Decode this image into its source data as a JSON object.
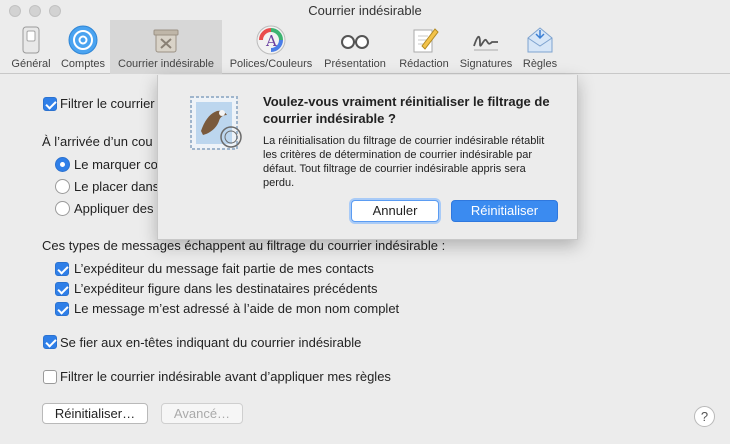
{
  "window": {
    "title": "Courrier indésirable"
  },
  "toolbar": {
    "items": [
      {
        "label": "Général",
        "icon": "general-switch-icon"
      },
      {
        "label": "Comptes",
        "icon": "at-sign-icon"
      },
      {
        "label": "Courrier indésirable",
        "icon": "junk-trash-icon",
        "active": true
      },
      {
        "label": "Polices/Couleurs",
        "icon": "font-colors-icon"
      },
      {
        "label": "Présentation",
        "icon": "glasses-icon"
      },
      {
        "label": "Rédaction",
        "icon": "pencil-notepad-icon"
      },
      {
        "label": "Signatures",
        "icon": "signature-icon"
      },
      {
        "label": "Règles",
        "icon": "rules-envelope-icon"
      }
    ]
  },
  "settings": {
    "filter_label": "Filtrer le courrier",
    "arrival_heading": "À l’arrivée d’un cou",
    "radio_mark": "Le marquer co",
    "radio_move": "Le placer dans",
    "radio_apply": "Appliquer des",
    "exceptions_heading": "Ces types de messages échappent au filtrage du courrier indésirable :",
    "exception_contacts": "L’expéditeur du message fait partie de mes contacts",
    "exception_previous": "L’expéditeur figure dans les destinataires précédents",
    "exception_fullname": "Le message m’est adressé à l’aide de mon nom complet",
    "trust_headers": "Se fier aux en-têtes indiquant du courrier indésirable",
    "filter_before_rules": "Filtrer le courrier indésirable avant d’appliquer mes règles",
    "reset_button": "Réinitialiser…",
    "advanced_button": "Avancé…",
    "help_glyph": "?"
  },
  "dialog": {
    "title": "Voulez-vous vraiment réinitialiser le filtrage de courrier indésirable ?",
    "message": "La réinitialisation du filtrage de courrier indésirable rétablit les critères de détermination de courrier indésirable par défaut. Tout filtrage de courrier indésirable appris sera perdu.",
    "cancel_label": "Annuler",
    "confirm_label": "Réinitialiser",
    "icon": "mail-stamp-eagle-icon"
  },
  "colors": {
    "accent": "#2f7fe8",
    "window_bg": "#ececec"
  }
}
